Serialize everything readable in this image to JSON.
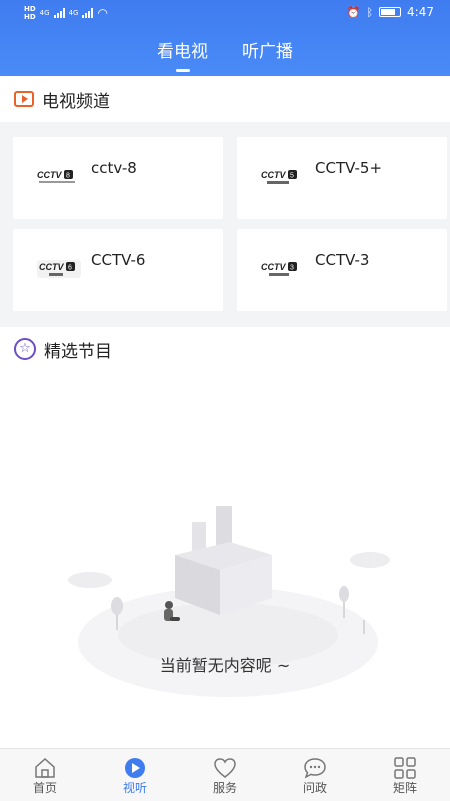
{
  "status_bar": {
    "left_top": "HD",
    "left_bottom": "HD",
    "network1": "4G",
    "network2": "4G",
    "time": "4:47"
  },
  "header": {
    "tabs": [
      {
        "label": "看电视",
        "active": true
      },
      {
        "label": "听广播",
        "active": false
      }
    ]
  },
  "tv_section": {
    "title": "电视频道",
    "channels": [
      {
        "name": "cctv-8",
        "logo_text": "CCTV 8"
      },
      {
        "name": "CCTV-5+",
        "logo_text": "CCTV 5"
      },
      {
        "name": "CCTV-6",
        "logo_text": "CCTV 6"
      },
      {
        "name": "CCTV-3",
        "logo_text": "CCTV 3"
      }
    ]
  },
  "featured_section": {
    "title": "精选节目",
    "empty_text": "当前暂无内容呢 ~"
  },
  "bottom_nav": {
    "items": [
      {
        "label": "首页",
        "icon": "home-icon",
        "active": false
      },
      {
        "label": "视听",
        "icon": "play-icon",
        "active": true
      },
      {
        "label": "服务",
        "icon": "heart-icon",
        "active": false
      },
      {
        "label": "问政",
        "icon": "chat-icon",
        "active": false
      },
      {
        "label": "矩阵",
        "icon": "grid-icon",
        "active": false
      }
    ]
  },
  "colors": {
    "primary": "#3f7cf0",
    "tv_icon": "#e8632a",
    "star_icon": "#6b4fc9"
  }
}
